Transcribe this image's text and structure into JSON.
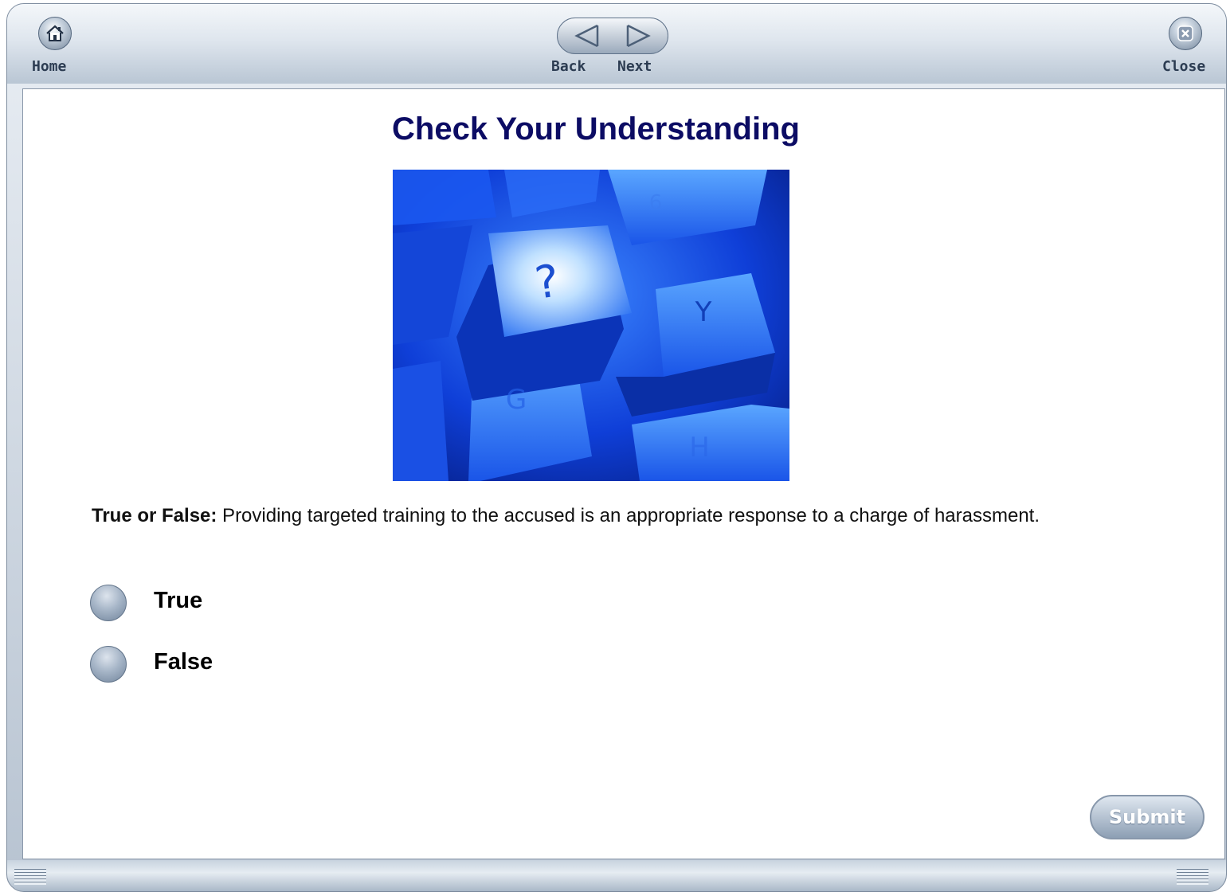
{
  "toolbar": {
    "home_label": "Home",
    "back_label": "Back",
    "next_label": "Next",
    "close_label": "Close"
  },
  "page": {
    "title": "Check Your Understanding"
  },
  "image": {
    "key_symbol": "?",
    "key_letters": [
      "6",
      "Y",
      "G",
      "H"
    ],
    "dominant_color": "#1f5cf0"
  },
  "question": {
    "prefix": "True or False:",
    "text": " Providing targeted training to the accused is an appropriate response to a charge of harassment."
  },
  "options": [
    {
      "label": "True"
    },
    {
      "label": "False"
    }
  ],
  "submit": {
    "label": "Submit"
  },
  "icons": {
    "home": "home-icon",
    "back": "left-arrow-icon",
    "next": "right-arrow-icon",
    "close": "close-icon",
    "grip": "grip-icon"
  }
}
